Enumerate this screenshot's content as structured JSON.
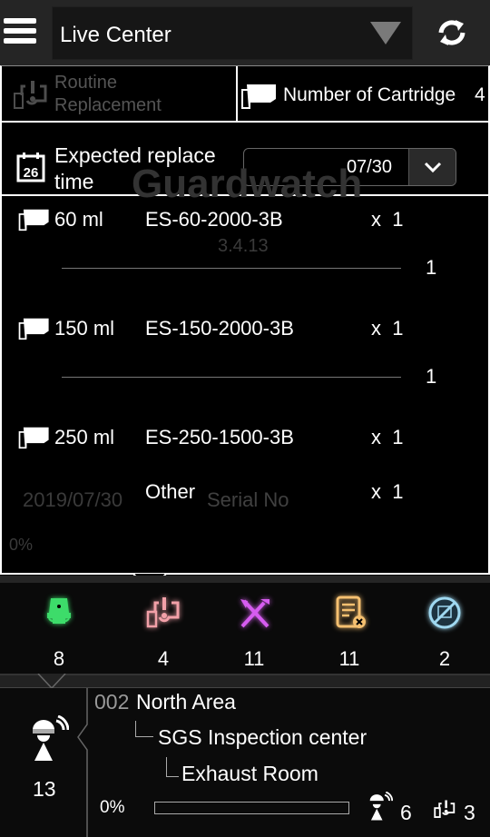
{
  "header": {
    "title": "Live Center",
    "menu_icon": "hamburger-icon",
    "dropdown_icon": "triangle-down-icon",
    "refresh_icon": "refresh-icon"
  },
  "background": {
    "brand": "Guardwatch",
    "version": "3.4.13",
    "date": "2019/07/30",
    "serial_placeholder": "Serial No",
    "percent": "0%"
  },
  "popup": {
    "routine_label": "Routine Replacement",
    "cartridge_label": "Number of Cartridge",
    "cartridge_count": "4",
    "expected_label_1": "Expected replace",
    "expected_label_2": "time",
    "expected_value": "07/30",
    "calendar_day": "26",
    "items": [
      {
        "size": "60 ml",
        "model": "ES-60-2000-3B",
        "qty": "x  1",
        "sub": "1"
      },
      {
        "size": "150 ml",
        "model": "ES-150-2000-3B",
        "qty": "x  1",
        "sub": "1"
      },
      {
        "size": "250 ml",
        "model": "ES-250-1500-3B",
        "qty": "x  1"
      },
      {
        "size": "",
        "model": "Other",
        "qty": "x  1"
      }
    ]
  },
  "stats": [
    {
      "icon": "sensor-icon",
      "color": "#3ddc6a",
      "count": "8"
    },
    {
      "icon": "routine-replacement-icon",
      "color": "#f2a0a8",
      "count": "4"
    },
    {
      "icon": "tools-icon",
      "color": "#d65cf0",
      "count": "11"
    },
    {
      "icon": "document-error-icon",
      "color": "#f5c070",
      "count": "11"
    },
    {
      "icon": "offline-icon",
      "color": "#9fd8f0",
      "count": "2"
    }
  ],
  "location": {
    "person_count": "13",
    "code": "002",
    "area": "North Area",
    "center": "SGS Inspection center",
    "room": "Exhaust Room",
    "progress_text": "0%",
    "progress": 0,
    "worker_count": "6",
    "replace_count": "3"
  }
}
